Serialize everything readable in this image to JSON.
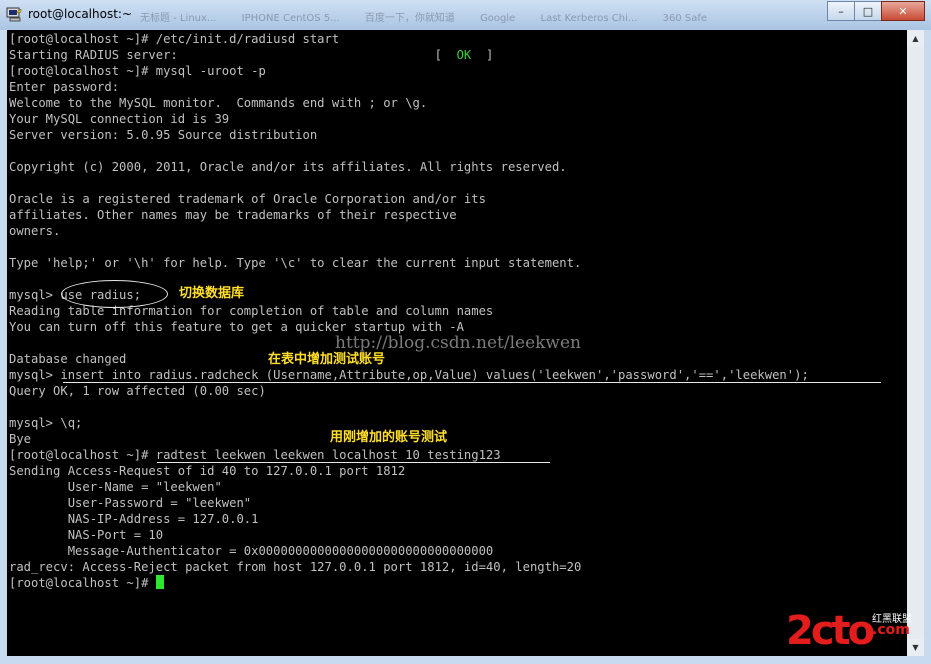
{
  "window": {
    "title": "root@localhost:~",
    "ghost_tabs": [
      "无标题 - Linux...",
      "IPHONE CentOS 5...",
      "百度一下，你就知道",
      "Google",
      "Last Kerberos Chi...",
      "360 Safe"
    ],
    "buttons": {
      "minimize": "–",
      "maximize": "□",
      "close": "✕"
    }
  },
  "terminal": {
    "lines": [
      "[root@localhost ~]# /etc/init.d/radiusd start",
      "Starting RADIUS server:                                   [  ",
      "[root@localhost ~]# mysql -uroot -p",
      "Enter password:",
      "Welcome to the MySQL monitor.  Commands end with ; or \\g.",
      "Your MySQL connection id is 39",
      "Server version: 5.0.95 Source distribution",
      "",
      "Copyright (c) 2000, 2011, Oracle and/or its affiliates. All rights reserved.",
      "",
      "Oracle is a registered trademark of Oracle Corporation and/or its",
      "affiliates. Other names may be trademarks of their respective",
      "owners.",
      "",
      "Type 'help;' or '\\h' for help. Type '\\c' to clear the current input statement.",
      "",
      "mysql> use radius;",
      "Reading table information for completion of table and column names",
      "You can turn off this feature to get a quicker startup with -A",
      "",
      "Database changed",
      "mysql> insert into radius.radcheck (Username,Attribute,op,Value) values('leekwen','password','==','leekwen');",
      "Query OK, 1 row affected (0.00 sec)",
      "",
      "mysql> \\q;",
      "Bye",
      "[root@localhost ~]# radtest leekwen leekwen localhost 10 testing123",
      "Sending Access-Request of id 40 to 127.0.0.1 port 1812",
      "        User-Name = \"leekwen\"",
      "        User-Password = \"leekwen\"",
      "        NAS-IP-Address = 127.0.0.1",
      "        NAS-Port = 10",
      "        Message-Authenticator = 0x00000000000000000000000000000000",
      "rad_recv: Access-Reject packet from host 127.0.0.1 port 1812, id=40, length=20",
      "[root@localhost ~]# "
    ],
    "ok_status": "OK",
    "ok_close": "  ]"
  },
  "annotations": {
    "switch_db": "切换数据库",
    "add_account": "在表中增加测试账号",
    "test_account": "用刚增加的账号测试"
  },
  "watermark": "http://blog.csdn.net/leekwen",
  "logo": {
    "main": "2cto",
    "sub1": "红黑联盟",
    "sub2": ".com"
  }
}
